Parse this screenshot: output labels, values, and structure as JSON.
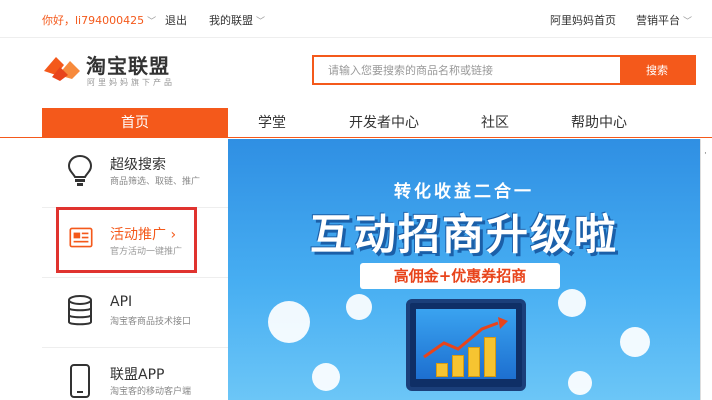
{
  "topbar": {
    "greeting": "你好，li794000425",
    "logout": "退出",
    "my_union": "我的联盟",
    "alimama_home": "阿里妈妈首页",
    "marketing_platform": "营销平台"
  },
  "header": {
    "logo_title": "淘宝联盟",
    "logo_subtitle": "阿里妈妈旗下产品",
    "search_placeholder": "请输入您要搜索的商品名称或链接",
    "search_button": "搜索"
  },
  "nav": {
    "tabs": [
      {
        "label": "首页",
        "active": true
      },
      {
        "label": "学堂"
      },
      {
        "label": "开发者中心"
      },
      {
        "label": "社区"
      },
      {
        "label": "帮助中心"
      }
    ]
  },
  "sidebar": {
    "items": [
      {
        "title": "超级搜索",
        "desc": "商品筛选、取链、推广",
        "icon": "lightbulb-icon"
      },
      {
        "title": "活动推广 ›",
        "desc": "官方活动一键推广",
        "icon": "newspaper-icon",
        "active": true
      },
      {
        "title": "API",
        "desc": "淘宝客商品技术接口",
        "icon": "database-icon"
      },
      {
        "title": "联盟APP",
        "desc": "淘宝客的移动客户端",
        "icon": "phone-icon"
      }
    ]
  },
  "banner": {
    "line1": "转化收益二合一",
    "line2": "互动招商升级啦",
    "pill": "高佣金+优惠券招商"
  },
  "colors": {
    "accent": "#f4591b",
    "highlight": "#e0332f",
    "banner_blue": "#2f8fe3"
  }
}
